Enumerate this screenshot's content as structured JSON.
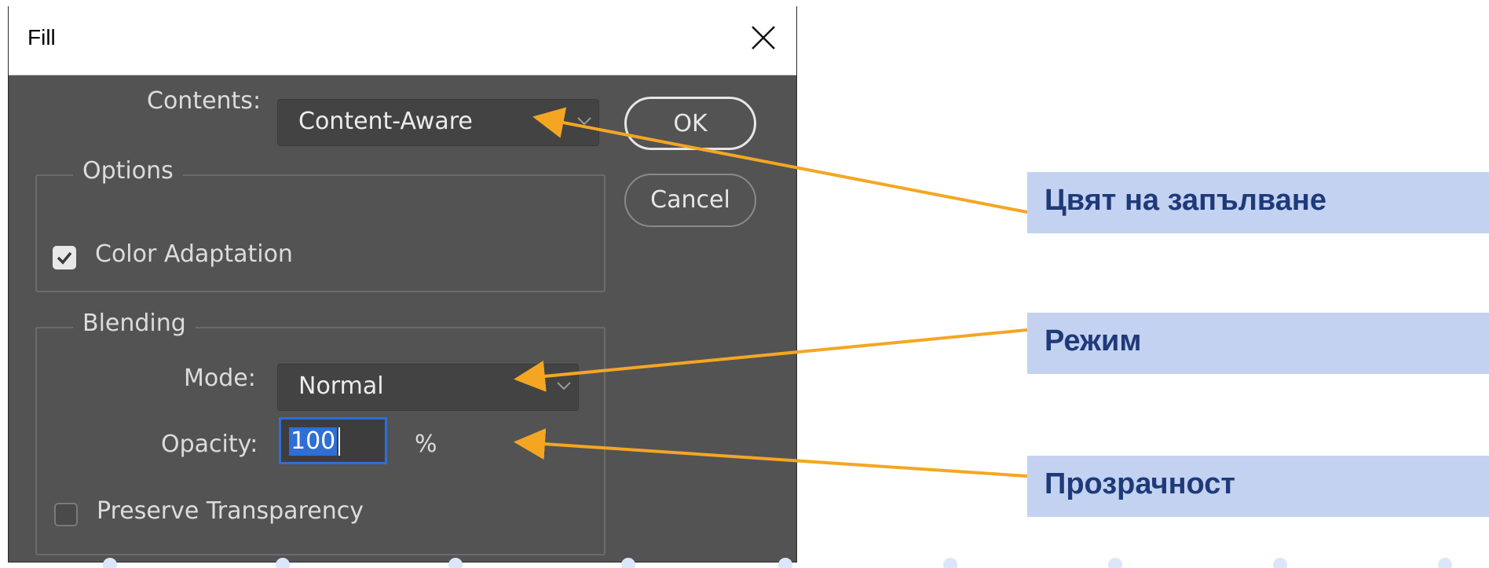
{
  "dialog": {
    "title": "Fill",
    "contents_label": "Contents:",
    "contents_value": "Content-Aware",
    "ok_label": "OK",
    "cancel_label": "Cancel",
    "options": {
      "legend": "Options",
      "color_adaptation_label": "Color Adaptation",
      "color_adaptation_checked": true
    },
    "blending": {
      "legend": "Blending",
      "mode_label": "Mode:",
      "mode_value": "Normal",
      "opacity_label": "Opacity:",
      "opacity_value": "100",
      "opacity_unit": "%",
      "preserve_transparency_label": "Preserve Transparency",
      "preserve_transparency_checked": false
    }
  },
  "annotations": [
    {
      "text": "Цвят на запълване"
    },
    {
      "text": "Режим"
    },
    {
      "text": "Прозрачност"
    }
  ],
  "colors": {
    "arrow": "#f4a623",
    "callout_bg": "#c3d2f0",
    "callout_text": "#1f3a7a",
    "dialog_bg": "#535353",
    "focus_blue": "#2f6fd6"
  },
  "icons": {
    "close": "close-icon",
    "dropdown": "chevron-down-icon",
    "check": "checkmark-icon"
  }
}
